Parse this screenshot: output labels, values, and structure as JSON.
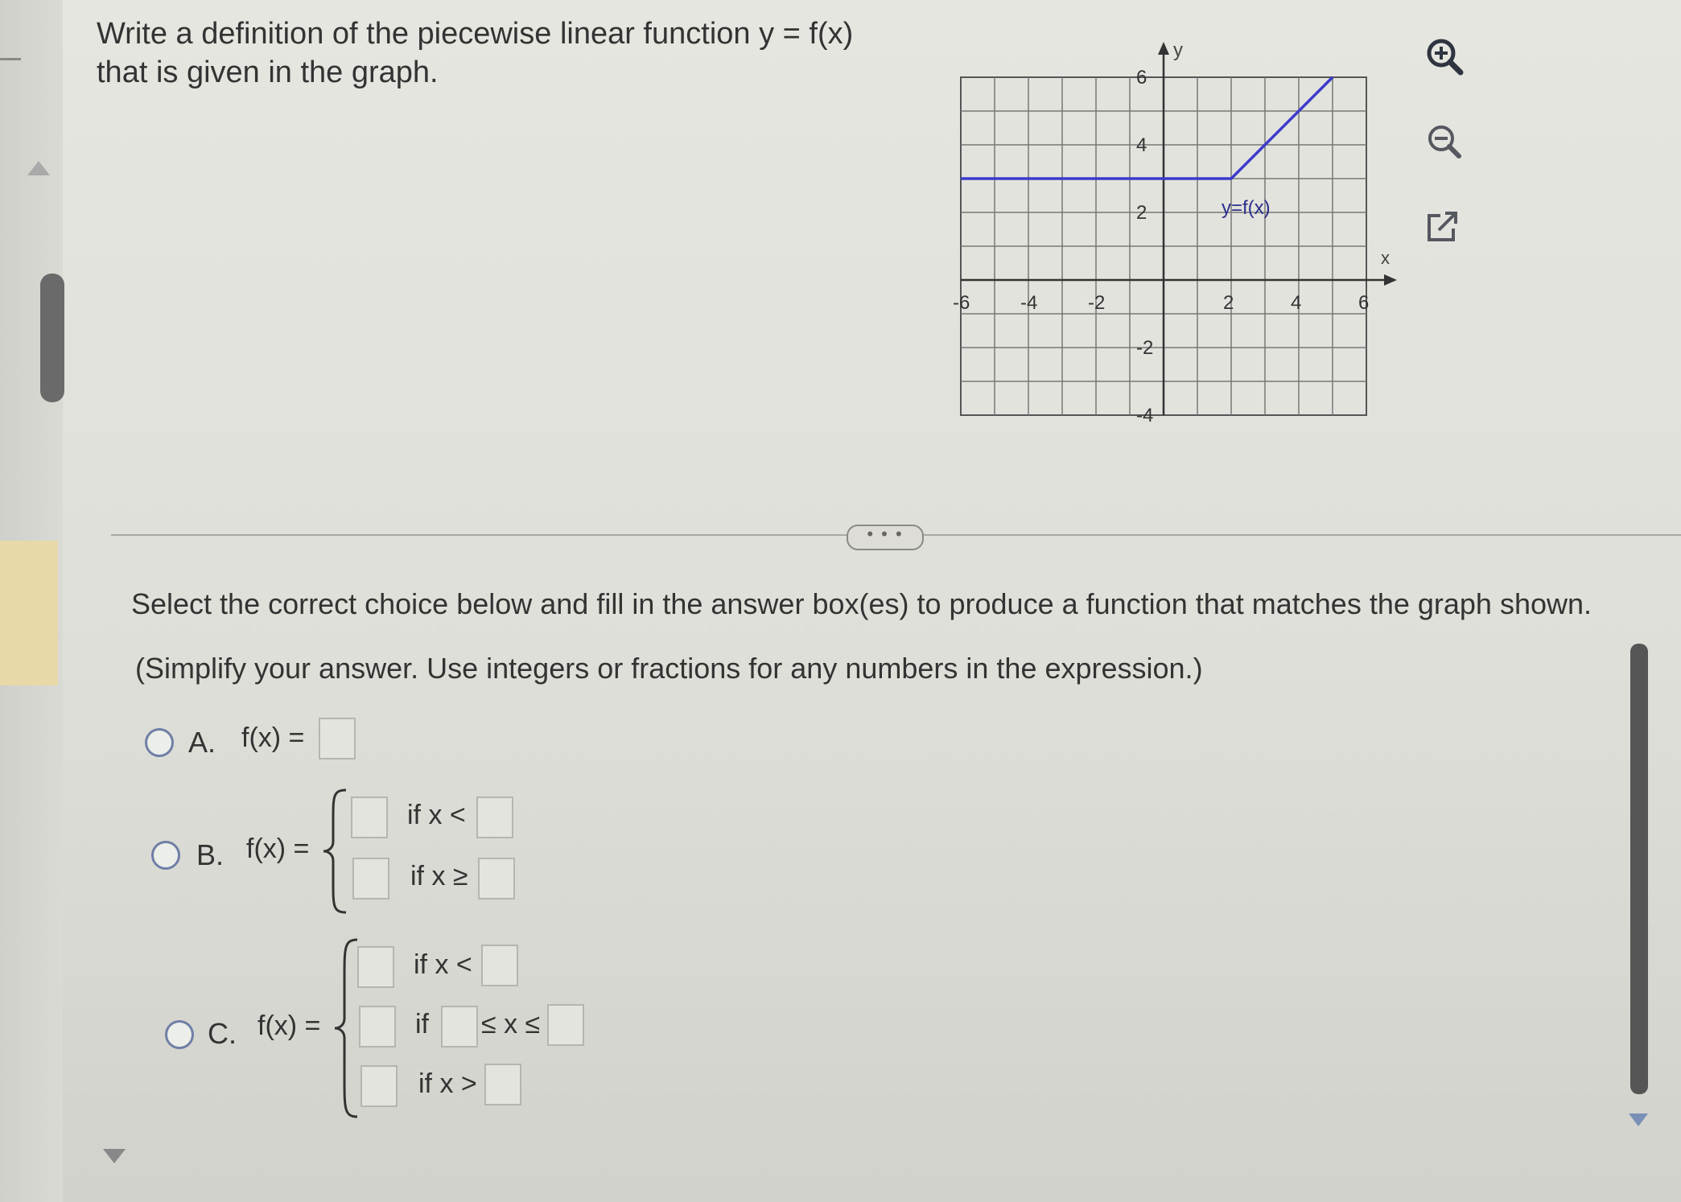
{
  "question": {
    "line1": "Write a definition of the piecewise linear function y = f(x)",
    "line2": "that is given in the graph."
  },
  "graph": {
    "x_axis_label": "x",
    "y_axis_label": "y",
    "function_label": "y=f(x)",
    "x_tick_labels": [
      "-6",
      "-4",
      "-2",
      "2",
      "4",
      "6"
    ],
    "y_tick_labels": [
      "6",
      "4",
      "2",
      "-2",
      "-4"
    ],
    "line_color": "#3b3bcc",
    "grid": true
  },
  "chart_data": {
    "type": "line",
    "title": "",
    "xlabel": "x",
    "ylabel": "y",
    "xlim": [
      -6,
      6
    ],
    "ylim": [
      -4,
      6
    ],
    "series": [
      {
        "name": "y=f(x)",
        "x": [
          -6,
          2,
          5
        ],
        "y": [
          3,
          3,
          6
        ]
      }
    ]
  },
  "tools": {
    "zoom_in": "zoom-in-icon",
    "zoom_out": "zoom-out-icon",
    "popout": "external-link-icon"
  },
  "more_button": "• • •",
  "instructions": "Select the correct choice below and fill in the answer box(es) to produce a function that matches the graph shown.",
  "simplify_note": "(Simplify your answer. Use integers or fractions for any numbers in the expression.)",
  "choices": {
    "a": {
      "letter": "A.",
      "fx": "f(x) ="
    },
    "b": {
      "letter": "B.",
      "fx": "f(x) =",
      "cond1": "if x <",
      "cond2": "if x ≥"
    },
    "c": {
      "letter": "C.",
      "fx": "f(x) =",
      "cond1": "if x <",
      "cond2_if": "if",
      "cond2_mid": "≤ x ≤",
      "cond3": "if x >"
    }
  }
}
